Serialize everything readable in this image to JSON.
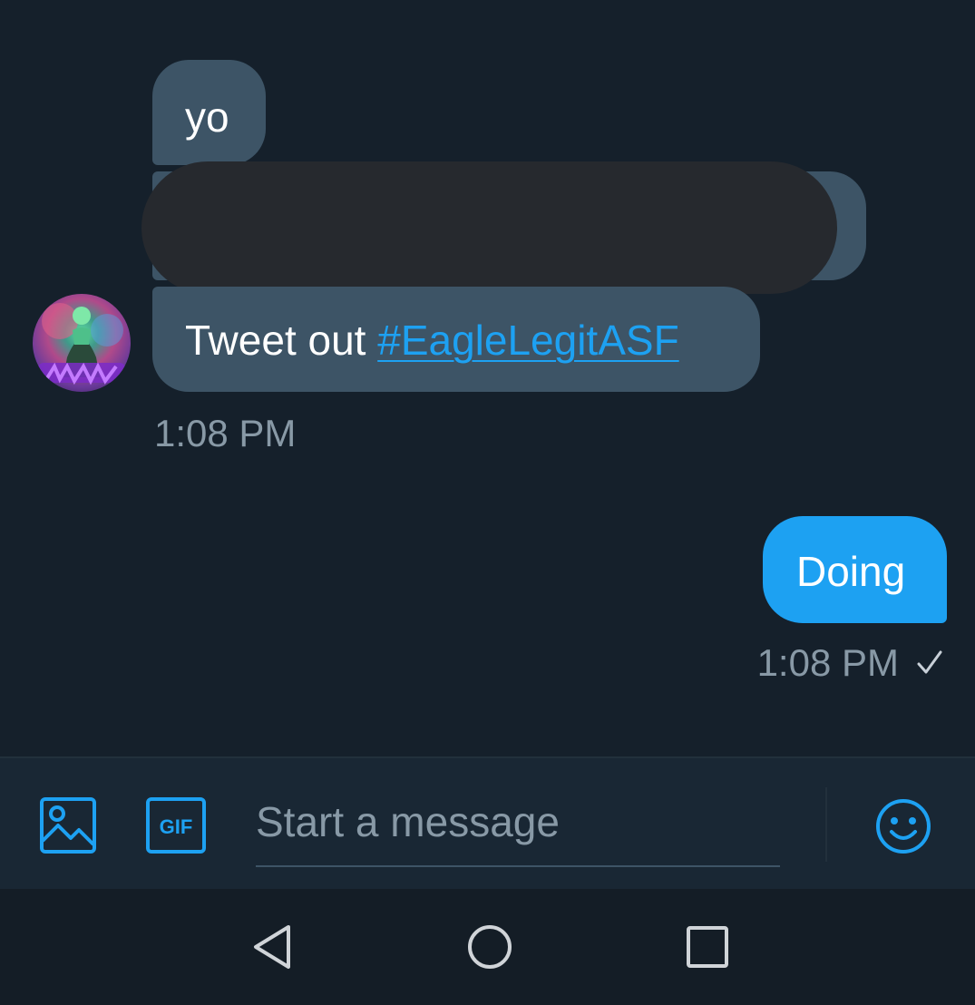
{
  "conversation": {
    "incoming": {
      "messages": [
        {
          "text": "yo"
        },
        {
          "text": ""
        },
        {
          "prefix": "Tweet out ",
          "link": "#EagleLegitASF"
        }
      ],
      "timestamp": "1:08 PM"
    },
    "outgoing": {
      "messages": [
        {
          "text": "Doing"
        }
      ],
      "timestamp": "1:08 PM"
    }
  },
  "composer": {
    "placeholder": "Start a message",
    "value": "",
    "gif_label": "GIF"
  },
  "icons": {
    "image": "image-icon",
    "gif": "gif-icon",
    "emoji": "emoji-icon",
    "check": "check-icon",
    "back": "nav-back-icon",
    "home": "nav-home-icon",
    "recents": "nav-recents-icon"
  },
  "colors": {
    "background": "#15202b",
    "incoming_bubble": "#3d5466",
    "outgoing_bubble": "#1da1f2",
    "link": "#1da1f2",
    "timestamp": "#8899a6",
    "composer_background": "#192734",
    "navbar_background": "#141d26"
  }
}
